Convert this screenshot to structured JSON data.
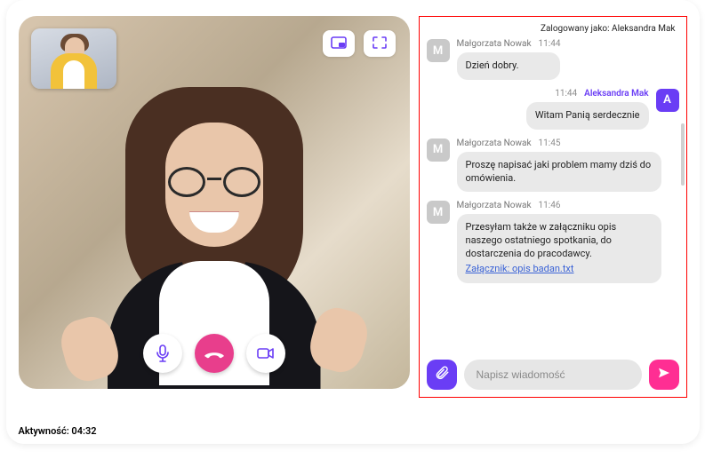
{
  "activity": {
    "label": "Aktywność: 04:32"
  },
  "video": {
    "pip_button": "picture-in-picture",
    "fullscreen_button": "fullscreen",
    "mic_button": "microphone",
    "hangup_button": "end-call",
    "camera_button": "camera"
  },
  "chat": {
    "logged_as_prefix": "Zalogowany jako:",
    "logged_as_user": "Aleksandra Mak",
    "composer": {
      "placeholder": "Napisz wiadomość",
      "attach_button": "attach",
      "send_button": "send"
    },
    "participants": {
      "other": {
        "name": "Małgorzata Nowak",
        "initial": "M"
      },
      "me": {
        "name": "Aleksandra Mak",
        "initial": "A"
      }
    },
    "messages": [
      {
        "from": "other",
        "name": "Małgorzata Nowak",
        "time": "11:44",
        "text": "Dzień dobry."
      },
      {
        "from": "me",
        "name": "Aleksandra Mak",
        "time": "11:44",
        "text": "Witam Panią serdecznie"
      },
      {
        "from": "other",
        "name": "Małgorzata Nowak",
        "time": "11:45",
        "text": "Proszę napisać jaki problem mamy dziś do omówienia."
      },
      {
        "from": "other",
        "name": "Małgorzata Nowak",
        "time": "11:46",
        "text": "Przesyłam także w załączniku opis naszego ostatniego spotkania, do dostarczenia do pracodawcy.",
        "attachment_label": "Załącznik: opis badan.txt"
      }
    ]
  }
}
